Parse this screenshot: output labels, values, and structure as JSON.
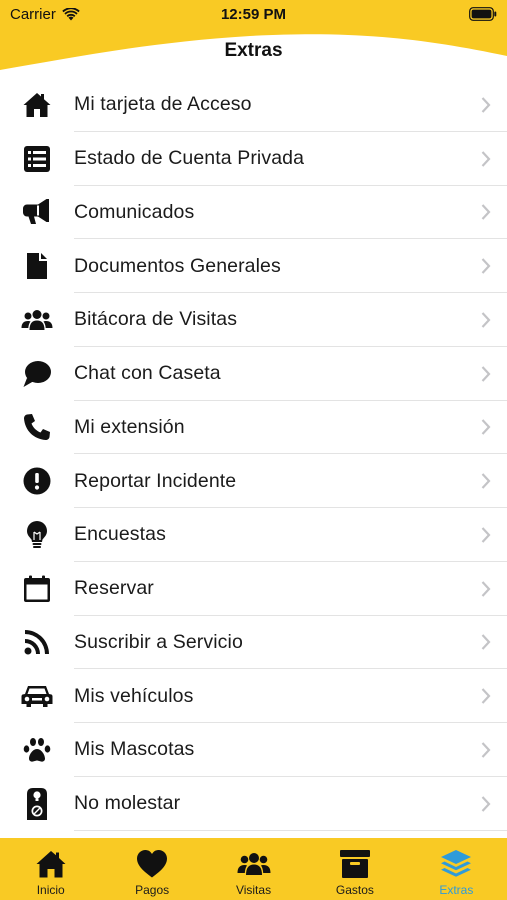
{
  "status_bar": {
    "carrier": "Carrier",
    "time": "12:59 PM"
  },
  "header": {
    "title": "Extras",
    "background_color": "#f9ca24"
  },
  "menu": [
    {
      "label": "Mi tarjeta de Acceso",
      "icon": "home-icon"
    },
    {
      "label": "Estado de Cuenta Privada",
      "icon": "list-icon"
    },
    {
      "label": "Comunicados",
      "icon": "megaphone-icon"
    },
    {
      "label": "Documentos Generales",
      "icon": "document-icon"
    },
    {
      "label": "Bitácora de Visitas",
      "icon": "users-icon"
    },
    {
      "label": "Chat con Caseta",
      "icon": "chat-icon"
    },
    {
      "label": "Mi extensión",
      "icon": "phone-icon"
    },
    {
      "label": "Reportar Incidente",
      "icon": "alert-icon"
    },
    {
      "label": "Encuestas",
      "icon": "lightbulb-icon"
    },
    {
      "label": "Reservar",
      "icon": "calendar-icon"
    },
    {
      "label": "Suscribir a Servicio",
      "icon": "rss-icon"
    },
    {
      "label": "Mis vehículos",
      "icon": "car-icon"
    },
    {
      "label": "Mis Mascotas",
      "icon": "paw-icon"
    },
    {
      "label": "No molestar",
      "icon": "do-not-disturb-icon"
    }
  ],
  "tabbar": {
    "tabs": [
      {
        "label": "Inicio",
        "icon": "home-icon"
      },
      {
        "label": "Pagos",
        "icon": "heart-icon"
      },
      {
        "label": "Visitas",
        "icon": "users-icon"
      },
      {
        "label": "Gastos",
        "icon": "archive-box-icon"
      },
      {
        "label": "Extras",
        "icon": "layers-icon"
      }
    ],
    "active_tab": "Extras",
    "active_color": "#2f9bd9"
  }
}
